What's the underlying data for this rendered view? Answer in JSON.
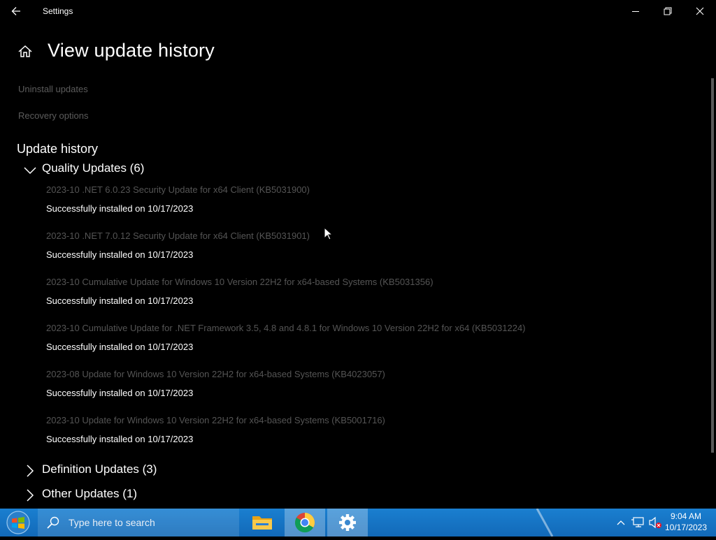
{
  "window": {
    "app_title": "Settings"
  },
  "page": {
    "title": "View update history"
  },
  "links": [
    "Uninstall updates",
    "Recovery options"
  ],
  "history": {
    "heading": "Update history",
    "quality": {
      "label": "Quality Updates (6)",
      "items": [
        {
          "name": "2023-10 .NET 6.0.23 Security Update for x64 Client (KB5031900)",
          "status": "Successfully installed on 10/17/2023"
        },
        {
          "name": "2023-10 .NET 7.0.12 Security Update for x64 Client (KB5031901)",
          "status": "Successfully installed on 10/17/2023"
        },
        {
          "name": "2023-10 Cumulative Update for Windows 10 Version 22H2 for x64-based Systems (KB5031356)",
          "status": "Successfully installed on 10/17/2023"
        },
        {
          "name": "2023-10 Cumulative Update for .NET Framework 3.5, 4.8 and 4.8.1 for Windows 10 Version 22H2 for x64 (KB5031224)",
          "status": "Successfully installed on 10/17/2023"
        },
        {
          "name": "2023-08 Update for Windows 10 Version 22H2 for x64-based Systems (KB4023057)",
          "status": "Successfully installed on 10/17/2023"
        },
        {
          "name": "2023-10 Update for Windows 10 Version 22H2 for x64-based Systems (KB5001716)",
          "status": "Successfully installed on 10/17/2023"
        }
      ]
    },
    "definition": {
      "label": "Definition Updates (3)"
    },
    "other": {
      "label": "Other Updates (1)"
    }
  },
  "taskbar": {
    "search_placeholder": "Type here to search",
    "time": "9:04 AM",
    "date": "10/17/2023"
  },
  "colors": {
    "taskbar": "#1269b8",
    "background": "#000000",
    "muted_text": "#555555"
  }
}
